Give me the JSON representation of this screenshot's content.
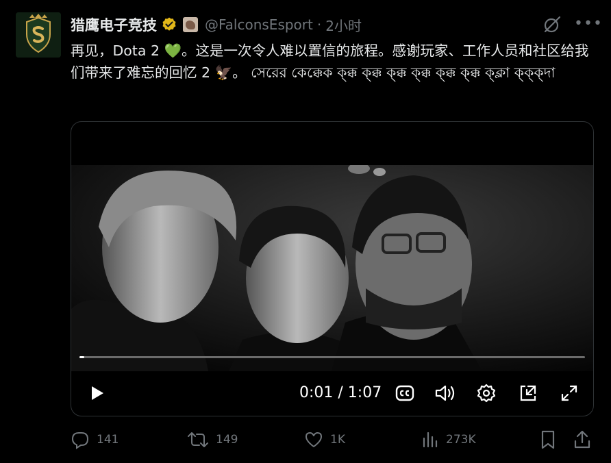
{
  "tweet": {
    "display_name": "猎鹰电子竞技",
    "handle": "@FalconsEsport",
    "separator": "·",
    "time": "2小时",
    "text_part1": "再见，Dota 2 ",
    "emoji_heart": "💚",
    "text_part2": "。这是一次令人难以置信的旅程。感谢玩家、工作人员和社区给我们带来了难忘的回忆 2 ",
    "emoji_falcon": "🦅",
    "text_part3": "。 সেরের কেক্কেক ক্ক্ক ক্ক্ক ক্ক্ক ক্ক্ক ক্ক্ক ক্ক্ক ক্ক্লা ক্ক্ক্দা"
  },
  "video": {
    "timecode": "0:01 / 1:07",
    "progress": 0.01
  },
  "actions": {
    "replies": "141",
    "reposts": "149",
    "likes": "1K",
    "views": "273K"
  },
  "colors": {
    "background": "#000000",
    "text": "#e7e9ea",
    "muted": "#71767b",
    "verified_gold": "#e2b719",
    "heart_green": "#22c55e"
  },
  "icons": [
    "falcons-logo-avatar",
    "verified-badge-icon",
    "affiliate-badge-icon",
    "grok-icon",
    "more-icon",
    "play-icon",
    "captions-icon",
    "volume-icon",
    "settings-icon",
    "pip-icon",
    "fullscreen-icon",
    "reply-icon",
    "repost-icon",
    "like-icon",
    "views-icon",
    "bookmark-icon",
    "share-icon"
  ]
}
